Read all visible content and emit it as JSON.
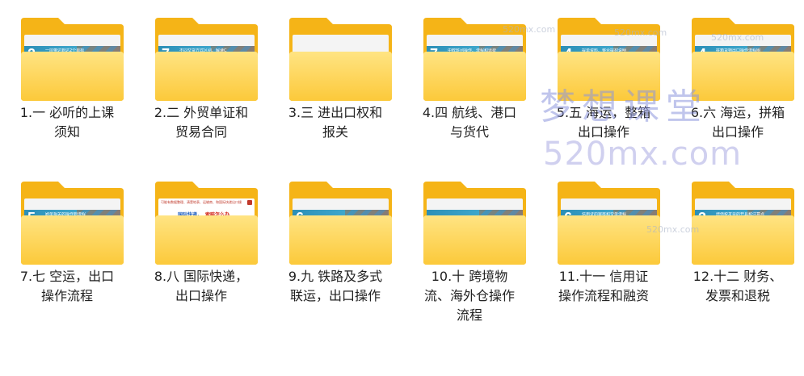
{
  "folders": [
    {
      "label_line1": "1.一 必听的上课",
      "label_line2": "须知",
      "thumb_num": "2",
      "thumb_caption": "一层带达到达2个目标",
      "thumb_type": "slide-band"
    },
    {
      "label_line1": "2.二 外贸单证和",
      "label_line2": "贸易合同",
      "thumb_num": "7",
      "thumb_caption": "不同交货方式区别、解读C",
      "thumb_type": "slide-band"
    },
    {
      "label_line1": "3.三 进出口权和",
      "label_line2": "报关",
      "thumb_num": "",
      "thumb_caption": "",
      "thumb_type": "blank"
    },
    {
      "label_line1": "4.四 航线、港口",
      "label_line2": "与货代",
      "thumb_num": "7",
      "thumb_caption": "中欧班列操作、流程和运费",
      "thumb_type": "slide-band"
    },
    {
      "label_line1": "5.五 海运，整箱",
      "label_line2": "出口操作",
      "thumb_num": "4",
      "thumb_caption": "提单资料、整合提材说明",
      "thumb_type": "slide-band"
    },
    {
      "label_line1": "6.六 海运，拼箱",
      "label_line2": "出口操作",
      "thumb_num": "4",
      "thumb_caption": "拼箱货物出口操作流程图",
      "thumb_type": "slide-band"
    },
    {
      "label_line1": "7.七 空运，出口",
      "label_line2": "操作流程",
      "thumb_num": "5",
      "thumb_caption": "刷单相关的操作到流程",
      "thumb_type": "slide-band"
    },
    {
      "label_line1": "8.八 国际快递，",
      "label_line2": "出口操作",
      "thumb_num": "",
      "thumb_caption": "",
      "thumb_type": "slide-white",
      "slide_head": "可能有数据整理、清楚地表、运输商、和国际快递出口操作的",
      "slide_t1": "国际快递，",
      "slide_t2": "索赔怎么办"
    },
    {
      "label_line1": "9.九 铁路及多式",
      "label_line2": "联运，出口操作",
      "thumb_num": "6",
      "thumb_caption": "",
      "thumb_type": "slide-band"
    },
    {
      "label_line1": "10.十 跨境物",
      "label_line2": "流、海外仓操作",
      "label_line3": "流程",
      "thumb_num": "",
      "thumb_caption": "",
      "thumb_type": "slide-band"
    },
    {
      "label_line1": "11.十一 信用证",
      "label_line2": "操作流程和融资",
      "thumb_num": "6",
      "thumb_caption": "信用证的审核和交单流程",
      "thumb_type": "slide-band"
    },
    {
      "label_line1": "12.十二 财务、",
      "label_line2": "发票和退税",
      "thumb_num": "3",
      "thumb_caption": "增值税发票的开具和注意点",
      "thumb_type": "slide-band"
    }
  ],
  "watermark": {
    "title": "梦想课堂",
    "domain": "520mx.com",
    "small": "520mx.com"
  },
  "colors": {
    "folder_back": "#f5b417",
    "folder_front_top": "#ffe483",
    "folder_front_bottom": "#fcc93a"
  }
}
